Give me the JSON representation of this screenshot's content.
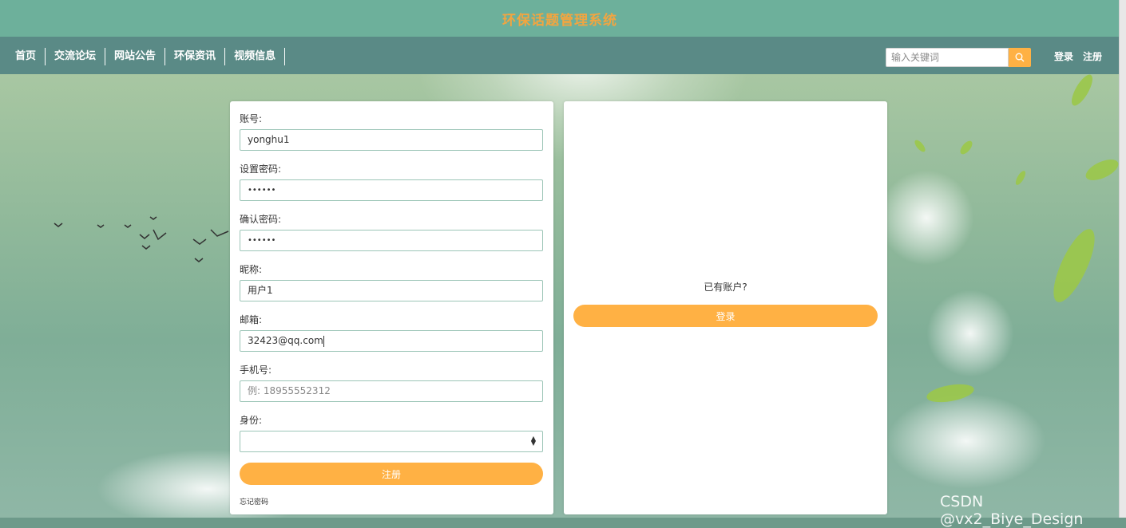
{
  "header": {
    "site_title": "环保话题管理系统"
  },
  "nav": {
    "items": [
      {
        "label": "首页"
      },
      {
        "label": "交流论坛"
      },
      {
        "label": "网站公告"
      },
      {
        "label": "环保资讯"
      },
      {
        "label": "视频信息"
      }
    ],
    "search_placeholder": "输入关键词",
    "search_icon": "search-icon",
    "login": "登录",
    "register": "注册"
  },
  "form": {
    "account_label": "账号:",
    "account_value": "yonghu1",
    "password_label": "设置密码:",
    "password_value": "••••••",
    "confirm_label": "确认密码:",
    "confirm_value": "••••••",
    "nickname_label": "昵称:",
    "nickname_value": "用户1",
    "email_label": "邮箱:",
    "email_value": "32423@qq.com",
    "phone_label": "手机号:",
    "phone_placeholder": "例: 18955552312",
    "role_label": "身份:",
    "role_value": "",
    "submit_label": "注册",
    "forgot_label": "忘记密码"
  },
  "side": {
    "prompt": "已有账户?",
    "login_label": "登录"
  },
  "watermark": "CSDN @vx2_Biye_Design",
  "colors": {
    "accent": "#ffb144",
    "title": "#f2a540",
    "topbar": "#6db09b",
    "navbar": "#5a8a86"
  }
}
